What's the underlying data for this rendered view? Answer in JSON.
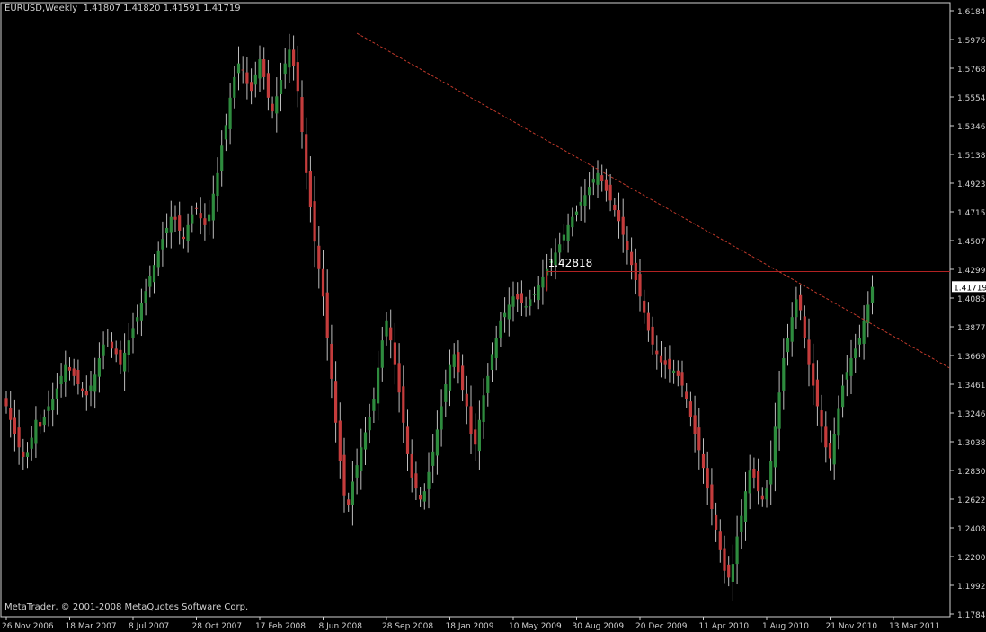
{
  "chart_data": {
    "type": "candlestick",
    "symbol": "EURUSD,Weekly",
    "header_values": [
      "1.41807",
      "1.41820",
      "1.41591",
      "1.41719"
    ],
    "copyright": "MetaTrader, © 2001-2008 MetaQuotes Software Corp.",
    "ylim": [
      1.1784,
      1.6184
    ],
    "y_ticks": [
      "1.61845",
      "1.59765",
      "1.57685",
      "1.55540",
      "1.53460",
      "1.51380",
      "1.49235",
      "1.47155",
      "1.45075",
      "1.42995",
      "1.40850",
      "1.38770",
      "1.36690",
      "1.34610",
      "1.32465",
      "1.30385",
      "1.28305",
      "1.26225",
      "1.24080",
      "1.22000",
      "1.19920",
      "1.17840"
    ],
    "x_ticks": [
      "26 Nov 2006",
      "18 Mar 2007",
      "8 Jul 2007",
      "28 Oct 2007",
      "17 Feb 2008",
      "8 Jun 2008",
      "28 Sep 2008",
      "18 Jan 2009",
      "10 May 2009",
      "30 Aug 2009",
      "20 Dec 2009",
      "11 Apr 2010",
      "1 Aug 2010",
      "21 Nov 2010",
      "13 Mar 2011"
    ],
    "current_price": "1.41719",
    "annotation": {
      "label": "1.42818",
      "value": 1.42818,
      "from_week": 128
    },
    "trendline": {
      "start_week": 83,
      "start_price": 1.602,
      "end_week": 210,
      "end_price": 1.381
    },
    "colors": {
      "bull": "#2e8b3e",
      "bear": "#c43c3c",
      "wick": "#bdbdbd",
      "axis": "#d0d0d0",
      "trend": "#c0392b",
      "hline": "#b22222",
      "badge": "#ffffff"
    },
    "weekly_close": [
      1.33,
      1.32,
      1.31,
      1.3,
      1.293,
      1.296,
      1.307,
      1.32,
      1.315,
      1.322,
      1.33,
      1.335,
      1.343,
      1.352,
      1.36,
      1.356,
      1.352,
      1.346,
      1.341,
      1.338,
      1.345,
      1.353,
      1.365,
      1.375,
      1.38,
      1.372,
      1.368,
      1.36,
      1.369,
      1.378,
      1.387,
      1.395,
      1.405,
      1.414,
      1.425,
      1.433,
      1.443,
      1.452,
      1.46,
      1.468,
      1.466,
      1.458,
      1.452,
      1.462,
      1.47,
      1.474,
      1.467,
      1.462,
      1.47,
      1.485,
      1.5,
      1.52,
      1.535,
      1.555,
      1.57,
      1.58,
      1.575,
      1.565,
      1.56,
      1.572,
      1.583,
      1.57,
      1.555,
      1.545,
      1.556,
      1.568,
      1.58,
      1.59,
      1.578,
      1.56,
      1.53,
      1.5,
      1.475,
      1.45,
      1.43,
      1.41,
      1.38,
      1.35,
      1.318,
      1.29,
      1.265,
      1.258,
      1.275,
      1.287,
      1.3,
      1.311,
      1.322,
      1.335,
      1.358,
      1.378,
      1.392,
      1.378,
      1.36,
      1.34,
      1.318,
      1.295,
      1.278,
      1.27,
      1.262,
      1.268,
      1.282,
      1.297,
      1.313,
      1.33,
      1.346,
      1.36,
      1.368,
      1.355,
      1.342,
      1.33,
      1.31,
      1.302,
      1.32,
      1.338,
      1.352,
      1.368,
      1.38,
      1.392,
      1.398,
      1.404,
      1.41,
      1.408,
      1.405,
      1.403,
      1.408,
      1.412,
      1.418,
      1.424,
      1.43,
      1.436,
      1.442,
      1.448,
      1.455,
      1.462,
      1.468,
      1.472,
      1.479,
      1.484,
      1.49,
      1.496,
      1.5,
      1.494,
      1.487,
      1.48,
      1.473,
      1.465,
      1.455,
      1.444,
      1.433,
      1.422,
      1.41,
      1.398,
      1.385,
      1.375,
      1.368,
      1.362,
      1.36,
      1.357,
      1.356,
      1.352,
      1.345,
      1.335,
      1.322,
      1.31,
      1.298,
      1.285,
      1.27,
      1.255,
      1.24,
      1.225,
      1.21,
      1.205,
      1.215,
      1.235,
      1.25,
      1.268,
      1.283,
      1.278,
      1.268,
      1.262,
      1.27,
      1.29,
      1.315,
      1.34,
      1.365,
      1.38,
      1.395,
      1.408,
      1.4,
      1.38,
      1.36,
      1.345,
      1.33,
      1.315,
      1.3,
      1.292,
      1.31,
      1.328,
      1.345,
      1.355,
      1.365,
      1.372,
      1.38,
      1.392,
      1.404,
      1.417
    ]
  }
}
